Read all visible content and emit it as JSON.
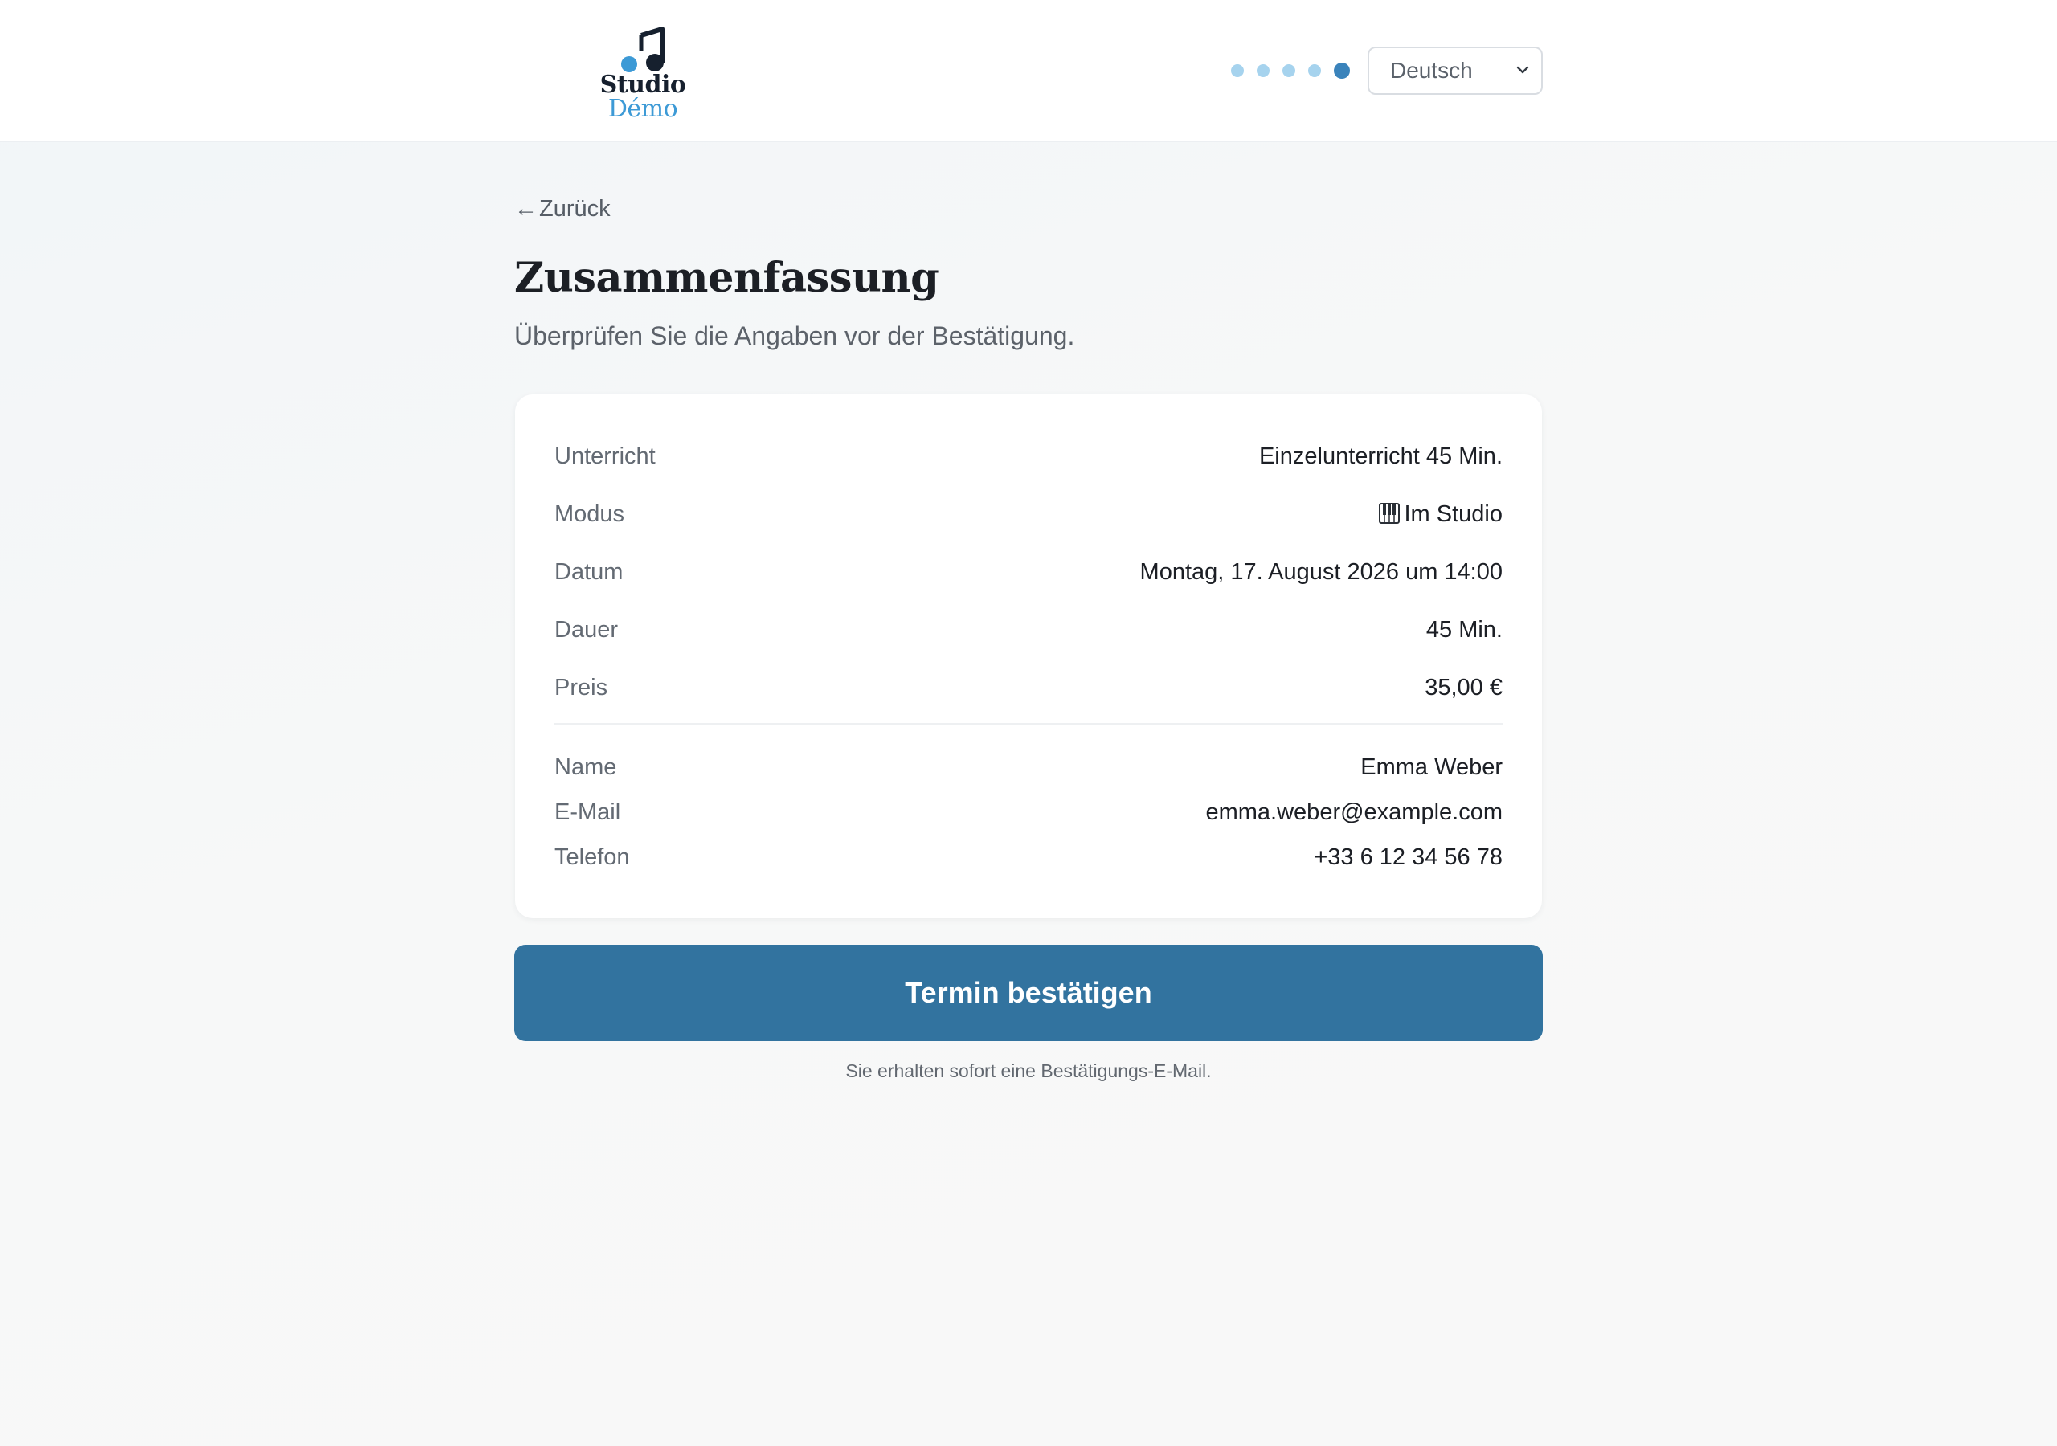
{
  "header": {
    "logo": {
      "line1": "Studio",
      "line2": "Démo",
      "icon": "music-note-icon",
      "colors": {
        "dark": "#16202e",
        "accent": "#3d9ad6"
      }
    },
    "steps": {
      "total": 5,
      "current": 5
    },
    "language": {
      "selected": "Deutsch"
    }
  },
  "nav": {
    "back_label": "Zurück",
    "back_icon": "arrow-left-icon"
  },
  "page": {
    "title": "Zusammenfassung",
    "subtitle": "Überprüfen Sie die Angaben vor der Bestätigung."
  },
  "summary": {
    "booking": [
      {
        "label": "Unterricht",
        "value": "Einzelunterricht 45 Min."
      },
      {
        "label": "Modus",
        "value": "Im Studio",
        "icon": "piano-icon"
      },
      {
        "label": "Datum",
        "value": "Montag, 17. August 2026 um 14:00"
      },
      {
        "label": "Dauer",
        "value": "45 Min."
      },
      {
        "label": "Preis",
        "value": "35,00 €"
      }
    ],
    "contact": [
      {
        "label": "Name",
        "value": "Emma Weber"
      },
      {
        "label": "E-Mail",
        "value": "emma.weber@example.com"
      },
      {
        "label": "Telefon",
        "value": "+33 6 12 34 56 78"
      }
    ]
  },
  "actions": {
    "confirm_label": "Termin bestätigen",
    "confirm_color": "#32739f",
    "note": "Sie erhalten sofort eine Bestätigungs-E-Mail."
  }
}
